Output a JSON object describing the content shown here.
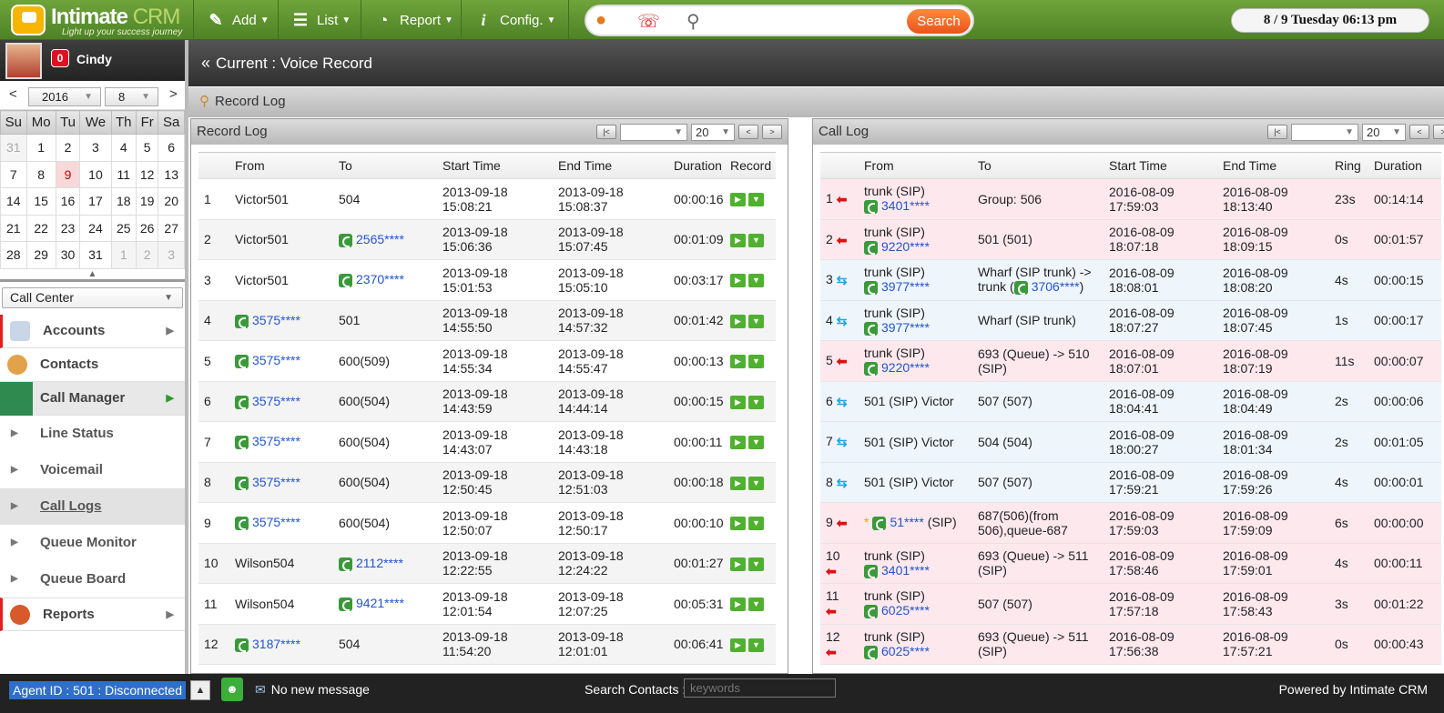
{
  "header": {
    "logo_main": "Intimate",
    "logo_accent": "CRM",
    "logo_tagline": "Light up your success journey",
    "menu": [
      {
        "label": "Add",
        "icon": "pencil-icon"
      },
      {
        "label": "List",
        "icon": "list-icon"
      },
      {
        "label": "Report",
        "icon": "report-icon"
      },
      {
        "label": "Config.",
        "icon": "info-icon"
      }
    ],
    "search_button": "Search",
    "datetime": "8 / 9  Tuesday  06:13 pm"
  },
  "user": {
    "name": "Cindy",
    "badge": "0"
  },
  "calendar": {
    "year": "2016",
    "month": "8",
    "prev": "<",
    "next": ">",
    "weekdays": [
      "Su",
      "Mo",
      "Tu",
      "We",
      "Th",
      "Fr",
      "Sa"
    ],
    "weeks": [
      [
        "31",
        "1",
        "2",
        "3",
        "4",
        "5",
        "6"
      ],
      [
        "7",
        "8",
        "9",
        "10",
        "11",
        "12",
        "13"
      ],
      [
        "14",
        "15",
        "16",
        "17",
        "18",
        "19",
        "20"
      ],
      [
        "21",
        "22",
        "23",
        "24",
        "25",
        "26",
        "27"
      ],
      [
        "28",
        "29",
        "30",
        "31",
        "1",
        "2",
        "3"
      ]
    ],
    "today": "9"
  },
  "module_select": "Call Center",
  "nav": {
    "accounts": "Accounts",
    "contacts": "Contacts",
    "call_manager": "Call Manager",
    "sub": [
      "Line Status",
      "Voicemail",
      "Call Logs",
      "Queue Monitor",
      "Queue Board"
    ],
    "reports": "Reports"
  },
  "breadcrumb": "Current : Voice Record",
  "subheader": "Record Log",
  "record_log": {
    "title": "Record Log",
    "page_size": "20",
    "first": "|<",
    "prev": "<",
    "next": ">",
    "columns": [
      "",
      "From",
      "To",
      "Start Time",
      "End Time",
      "Duration",
      "Record"
    ],
    "rows": [
      {
        "n": "1",
        "from": "Victor501",
        "from_phone": false,
        "to": "504",
        "to_phone": false,
        "start_date": "2013-09-18",
        "start_time": "15:08:21",
        "end_date": "2013-09-18",
        "end_time": "15:08:37",
        "duration": "00:00:16"
      },
      {
        "n": "2",
        "from": "Victor501",
        "from_phone": false,
        "to": "2565****",
        "to_phone": true,
        "start_date": "2013-09-18",
        "start_time": "15:06:36",
        "end_date": "2013-09-18",
        "end_time": "15:07:45",
        "duration": "00:01:09"
      },
      {
        "n": "3",
        "from": "Victor501",
        "from_phone": false,
        "to": "2370****",
        "to_phone": true,
        "start_date": "2013-09-18",
        "start_time": "15:01:53",
        "end_date": "2013-09-18",
        "end_time": "15:05:10",
        "duration": "00:03:17"
      },
      {
        "n": "4",
        "from": "3575****",
        "from_phone": true,
        "to": "501",
        "to_phone": false,
        "start_date": "2013-09-18",
        "start_time": "14:55:50",
        "end_date": "2013-09-18",
        "end_time": "14:57:32",
        "duration": "00:01:42"
      },
      {
        "n": "5",
        "from": "3575****",
        "from_phone": true,
        "to": "600(509)",
        "to_phone": false,
        "start_date": "2013-09-18",
        "start_time": "14:55:34",
        "end_date": "2013-09-18",
        "end_time": "14:55:47",
        "duration": "00:00:13"
      },
      {
        "n": "6",
        "from": "3575****",
        "from_phone": true,
        "to": "600(504)",
        "to_phone": false,
        "start_date": "2013-09-18",
        "start_time": "14:43:59",
        "end_date": "2013-09-18",
        "end_time": "14:44:14",
        "duration": "00:00:15"
      },
      {
        "n": "7",
        "from": "3575****",
        "from_phone": true,
        "to": "600(504)",
        "to_phone": false,
        "start_date": "2013-09-18",
        "start_time": "14:43:07",
        "end_date": "2013-09-18",
        "end_time": "14:43:18",
        "duration": "00:00:11"
      },
      {
        "n": "8",
        "from": "3575****",
        "from_phone": true,
        "to": "600(504)",
        "to_phone": false,
        "start_date": "2013-09-18",
        "start_time": "12:50:45",
        "end_date": "2013-09-18",
        "end_time": "12:51:03",
        "duration": "00:00:18"
      },
      {
        "n": "9",
        "from": "3575****",
        "from_phone": true,
        "to": "600(504)",
        "to_phone": false,
        "start_date": "2013-09-18",
        "start_time": "12:50:07",
        "end_date": "2013-09-18",
        "end_time": "12:50:17",
        "duration": "00:00:10"
      },
      {
        "n": "10",
        "from": "Wilson504",
        "from_phone": false,
        "to": "2112****",
        "to_phone": true,
        "start_date": "2013-09-18",
        "start_time": "12:22:55",
        "end_date": "2013-09-18",
        "end_time": "12:24:22",
        "duration": "00:01:27"
      },
      {
        "n": "11",
        "from": "Wilson504",
        "from_phone": false,
        "to": "9421****",
        "to_phone": true,
        "start_date": "2013-09-18",
        "start_time": "12:01:54",
        "end_date": "2013-09-18",
        "end_time": "12:07:25",
        "duration": "00:05:31"
      },
      {
        "n": "12",
        "from": "3187****",
        "from_phone": true,
        "to": "504",
        "to_phone": false,
        "start_date": "2013-09-18",
        "start_time": "11:54:20",
        "end_date": "2013-09-18",
        "end_time": "12:01:01",
        "duration": "00:06:41"
      }
    ]
  },
  "call_log": {
    "title": "Call Log",
    "page_size": "20",
    "first": "|<",
    "prev": "<",
    "next": ">",
    "columns": [
      "",
      "From",
      "To",
      "Start Time",
      "End Time",
      "Ring",
      "Duration"
    ],
    "rows": [
      {
        "n": "1",
        "dir": "in",
        "from_line1": "trunk (SIP)",
        "from_num": "3401****",
        "to_line1": "Group: 506",
        "to_line2": "",
        "to_num": "",
        "start_date": "2016-08-09",
        "start_time": "17:59:03",
        "end_date": "2016-08-09",
        "end_time": "18:13:40",
        "ring": "23s",
        "duration": "00:14:14"
      },
      {
        "n": "2",
        "dir": "in",
        "from_line1": "trunk (SIP)",
        "from_num": "9220****",
        "to_line1": "501 (501)",
        "to_line2": "",
        "to_num": "",
        "start_date": "2016-08-09",
        "start_time": "18:07:18",
        "end_date": "2016-08-09",
        "end_time": "18:09:15",
        "ring": "0s",
        "duration": "00:01:57"
      },
      {
        "n": "3",
        "dir": "ext",
        "from_line1": "trunk (SIP)",
        "from_num": "3977****",
        "to_line1": "Wharf (SIP trunk) ->",
        "to_line2": "trunk (",
        "to_num": "3706****",
        "start_date": "2016-08-09",
        "start_time": "18:08:01",
        "end_date": "2016-08-09",
        "end_time": "18:08:20",
        "ring": "4s",
        "duration": "00:00:15"
      },
      {
        "n": "4",
        "dir": "ext",
        "from_line1": "trunk (SIP)",
        "from_num": "3977****",
        "to_line1": "Wharf (SIP trunk)",
        "to_line2": "",
        "to_num": "",
        "start_date": "2016-08-09",
        "start_time": "18:07:27",
        "end_date": "2016-08-09",
        "end_time": "18:07:45",
        "ring": "1s",
        "duration": "00:00:17"
      },
      {
        "n": "5",
        "dir": "in",
        "from_line1": "trunk (SIP)",
        "from_num": "9220****",
        "to_line1": "693 (Queue) -> 510",
        "to_line2": "(SIP)",
        "to_num": "",
        "start_date": "2016-08-09",
        "start_time": "18:07:01",
        "end_date": "2016-08-09",
        "end_time": "18:07:19",
        "ring": "11s",
        "duration": "00:00:07"
      },
      {
        "n": "6",
        "dir": "ext",
        "from_line1": "501 (SIP) Victor",
        "from_num": "",
        "to_line1": "507 (507)",
        "to_line2": "",
        "to_num": "",
        "start_date": "2016-08-09",
        "start_time": "18:04:41",
        "end_date": "2016-08-09",
        "end_time": "18:04:49",
        "ring": "2s",
        "duration": "00:00:06"
      },
      {
        "n": "7",
        "dir": "ext",
        "from_line1": "501 (SIP) Victor",
        "from_num": "",
        "to_line1": "504 (504)",
        "to_line2": "",
        "to_num": "",
        "start_date": "2016-08-09",
        "start_time": "18:00:27",
        "end_date": "2016-08-09",
        "end_time": "18:01:34",
        "ring": "2s",
        "duration": "00:01:05"
      },
      {
        "n": "8",
        "dir": "ext",
        "from_line1": "501 (SIP) Victor",
        "from_num": "",
        "to_line1": "507 (507)",
        "to_line2": "",
        "to_num": "",
        "start_date": "2016-08-09",
        "start_time": "17:59:21",
        "end_date": "2016-08-09",
        "end_time": "17:59:26",
        "ring": "4s",
        "duration": "00:00:01"
      },
      {
        "n": "9",
        "dir": "in",
        "from_line1": "",
        "from_num": "51****",
        "from_suffix": " (SIP)",
        "star": "*",
        "to_line1": "687(506)(from",
        "to_line2": "506),queue-687",
        "to_num": "",
        "start_date": "2016-08-09",
        "start_time": "17:59:03",
        "end_date": "2016-08-09",
        "end_time": "17:59:09",
        "ring": "6s",
        "duration": "00:00:00"
      },
      {
        "n": "10",
        "dir": "in",
        "from_line1": "trunk (SIP)",
        "from_num": "3401****",
        "to_line1": "693 (Queue) -> 511",
        "to_line2": "(SIP)",
        "to_num": "",
        "start_date": "2016-08-09",
        "start_time": "17:58:46",
        "end_date": "2016-08-09",
        "end_time": "17:59:01",
        "ring": "4s",
        "duration": "00:00:11"
      },
      {
        "n": "11",
        "dir": "in",
        "from_line1": "trunk (SIP)",
        "from_num": "6025****",
        "to_line1": "507 (507)",
        "to_line2": "",
        "to_num": "",
        "start_date": "2016-08-09",
        "start_time": "17:57:18",
        "end_date": "2016-08-09",
        "end_time": "17:58:43",
        "ring": "3s",
        "duration": "00:01:22"
      },
      {
        "n": "12",
        "dir": "in",
        "from_line1": "trunk (SIP)",
        "from_num": "6025****",
        "to_line1": "693 (Queue) -> 511",
        "to_line2": "(SIP)",
        "to_num": "",
        "start_date": "2016-08-09",
        "start_time": "17:56:38",
        "end_date": "2016-08-09",
        "end_time": "17:57:21",
        "ring": "0s",
        "duration": "00:00:43"
      }
    ]
  },
  "status": {
    "agent": "Agent ID : 501 : Disconnected",
    "message": "No new message",
    "search_label": "Search Contacts :",
    "search_placeholder": "keywords",
    "powered": "Powered by Intimate CRM"
  }
}
